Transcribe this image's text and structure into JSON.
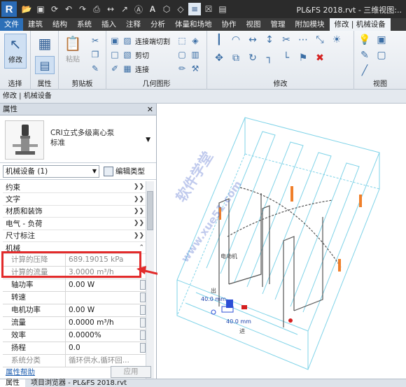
{
  "titlebar": {
    "app_logo": "R",
    "doc_title": "PL&FS 2018.rvt - 三维视图:..",
    "qat_icons": [
      "open-icon",
      "save-icon",
      "sync-icon",
      "undo-icon",
      "redo-icon",
      "print-icon",
      "measure-icon",
      "dimension-icon",
      "tag-icon",
      "text-icon",
      "3d-view-icon",
      "section-icon",
      "thin-lines-icon",
      "close-hidden-icon",
      "switch-windows-icon"
    ]
  },
  "tabs": [
    "文件",
    "建筑",
    "结构",
    "系统",
    "插入",
    "注释",
    "分析",
    "体量和场地",
    "协作",
    "视图",
    "管理",
    "附加模块",
    "修改 | 机械设备"
  ],
  "ribbon": {
    "select_panel": {
      "button": "修改",
      "label": "选择"
    },
    "properties_panel": {
      "label": "属性"
    },
    "clipboard_panel": {
      "paste": "粘贴",
      "label": "剪贴板"
    },
    "geometry_panel": {
      "join_cut": "连接端切割",
      "cut": "剪切",
      "join": "连接",
      "label": "几何图形"
    },
    "modify_panel": {
      "label": "修改"
    },
    "view_panel": {
      "label": "视图"
    }
  },
  "context_bar": "修改 | 机械设备",
  "properties": {
    "header": "属性",
    "type_name_line1": "CRI立式多级离心泵",
    "type_name_line2": "标准",
    "filter": "机械设备 (1)",
    "edit_type": "编辑类型",
    "groups": [
      "约束",
      "文字",
      "材质和装饰",
      "电气 - 负荷",
      "尺寸标注",
      "机械"
    ],
    "rows": [
      {
        "key": "计算的压降",
        "value": "689.19015 kPa",
        "readonly": true
      },
      {
        "key": "计算的流量",
        "value": "3.0000 m³/h",
        "readonly": true
      },
      {
        "key": "轴功率",
        "value": "0.00 W",
        "readonly": false
      },
      {
        "key": "转速",
        "value": "",
        "readonly": false
      },
      {
        "key": "电机功率",
        "value": "0.00 W",
        "readonly": false
      },
      {
        "key": "流量",
        "value": "0.0000 m³/h",
        "readonly": false
      },
      {
        "key": "效率",
        "value": "0.0000%",
        "readonly": false
      },
      {
        "key": "扬程",
        "value": "0.0",
        "readonly": false
      },
      {
        "key": "系统分类",
        "value": "循环供水,循环回...",
        "readonly": true
      }
    ],
    "help_link": "属性帮助",
    "apply": "应用"
  },
  "bottom_tabs": [
    "属性",
    "项目浏览器 - PL&FS 2018.rvt"
  ],
  "viewport": {
    "dim_label_1": "40.0 mm",
    "dim_label_2": "40.0 mm",
    "tag_1": "电动机",
    "tag_2": "出",
    "tag_3": "进",
    "watermark_1": "软件学堂",
    "watermark_2": "www.xue51.com"
  },
  "colors": {
    "titlebar": "#2b2b2b",
    "file_tab": "#2c6fb7",
    "highlight": "#e22b2b",
    "model_lines": "#7fd3e8",
    "orange": "#f07f2a"
  }
}
